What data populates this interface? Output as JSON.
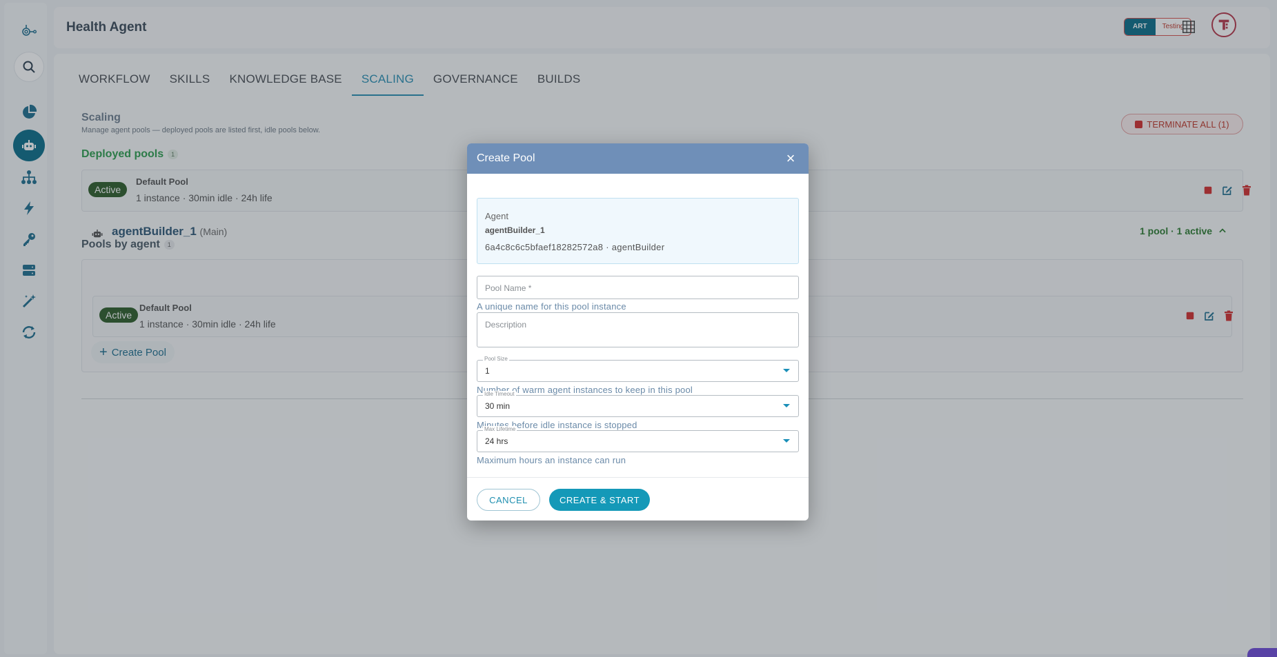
{
  "header": {
    "app_title": "Health Agent",
    "env_art": "ART",
    "env_testing": "Testing"
  },
  "tabs": [
    {
      "label": "WORKFLOW"
    },
    {
      "label": "SKILLS"
    },
    {
      "label": "KNOWLEDGE BASE"
    },
    {
      "label": "SCALING"
    },
    {
      "label": "GOVERNANCE"
    },
    {
      "label": "BUILDS"
    }
  ],
  "active_tab": "SCALING",
  "scaling": {
    "title": "Scaling",
    "subtitle": "Manage agent pools — deployed pools are listed first, idle pools below.",
    "terminate_label": "TERMINATE ALL (1)"
  },
  "deployed": {
    "title": "Deployed pools",
    "count": "1",
    "pool": {
      "status": "Active",
      "name": "Default Pool",
      "meta": "1 instance · 30min idle · 24h life"
    }
  },
  "by_agent": {
    "title": "Pools by agent",
    "count": "1",
    "agent_name": "agentBuilder_1",
    "agent_tag": "(Main)",
    "summary": "1 pool · 1 active",
    "pool": {
      "status": "Active",
      "name": "Default Pool",
      "meta": "1 instance · 30min idle · 24h life"
    },
    "create_pool_label": "Create Pool"
  },
  "modal": {
    "title": "Create Pool",
    "close_icon": "×",
    "agent_label": "Agent",
    "agent_name": "agentBuilder_1",
    "agent_id_line": "6a4c8c6c5bfaef18282572a8 · agentBuilder",
    "pool_name_placeholder": "Pool Name *",
    "pool_name_helper": "A unique name for this pool instance",
    "description_placeholder": "Description",
    "pool_size_label": "Pool Size",
    "pool_size_value": "1",
    "pool_size_helper": "Number of warm agent instances to keep in this pool",
    "idle_timeout_label": "Idle Timeout",
    "idle_timeout_value": "30 min",
    "idle_timeout_helper": "Minutes before idle instance is stopped",
    "max_lifetime_label": "Max Lifetime",
    "max_lifetime_value": "24 hrs",
    "max_lifetime_helper": "Maximum hours an instance can run",
    "cancel_label": "CANCEL",
    "create_label": "CREATE & START"
  },
  "colors": {
    "accent": "#1499b8",
    "brand_dark": "#0b6d8a",
    "active_green": "#2e5d2a",
    "danger": "#d32f2f",
    "modal_header": "#6f8fb8"
  },
  "icons": {
    "logo": "app-logo-icon",
    "search": "search-icon",
    "analytics": "pie-chart-icon",
    "agents": "robot-icon",
    "org": "hierarchy-icon",
    "actions": "lightning-icon",
    "keys": "key-icon",
    "storage": "server-icon",
    "magic": "magic-wand-icon",
    "sync": "sync-icon",
    "grid": "apps-grid-icon"
  }
}
